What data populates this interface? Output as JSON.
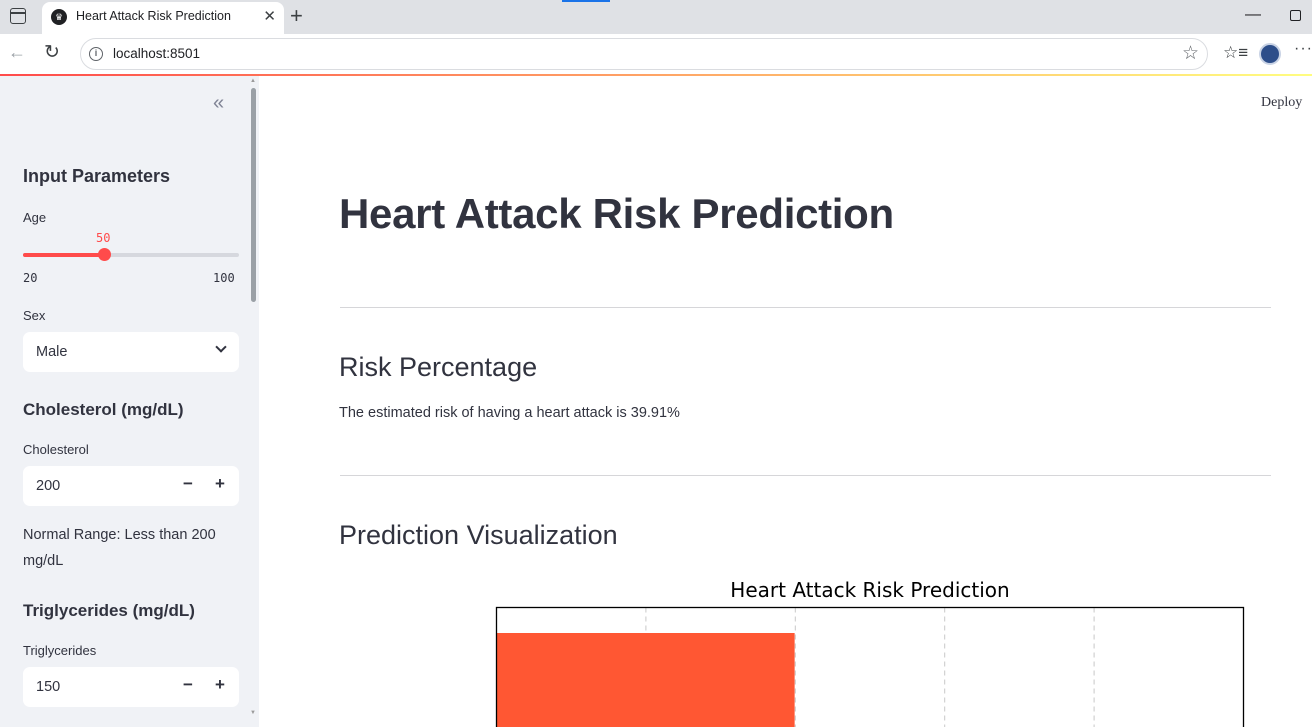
{
  "browser": {
    "tab_title": "Heart Attack Risk Prediction",
    "url": "localhost:8501"
  },
  "sidebar": {
    "section_title": "Input Parameters",
    "age": {
      "label": "Age",
      "value": "50",
      "min": "20",
      "max": "100",
      "fraction": 0.375
    },
    "sex": {
      "label": "Sex",
      "value": "Male"
    },
    "cholesterol": {
      "heading": "Cholesterol (mg/dL)",
      "label": "Cholesterol",
      "value": "200",
      "note": "Normal Range: Less than 200 mg/dL"
    },
    "triglycerides": {
      "heading": "Triglycerides (mg/dL)",
      "label": "Triglycerides",
      "value": "150"
    }
  },
  "main": {
    "deploy_label": "Deploy",
    "title": "Heart Attack Risk Prediction",
    "risk_heading": "Risk Percentage",
    "risk_text": "The estimated risk of having a heart attack is 39.91%",
    "viz_heading": "Prediction Visualization"
  },
  "colors": {
    "accent": "#ff4b4b",
    "bar": "#ff5733",
    "sidebar_bg": "#f0f2f6"
  },
  "chart_data": {
    "type": "bar",
    "orientation": "horizontal",
    "title": "Heart Attack Risk Prediction",
    "values": [
      39.91
    ],
    "xlim": [
      0,
      100
    ],
    "grid": true
  }
}
